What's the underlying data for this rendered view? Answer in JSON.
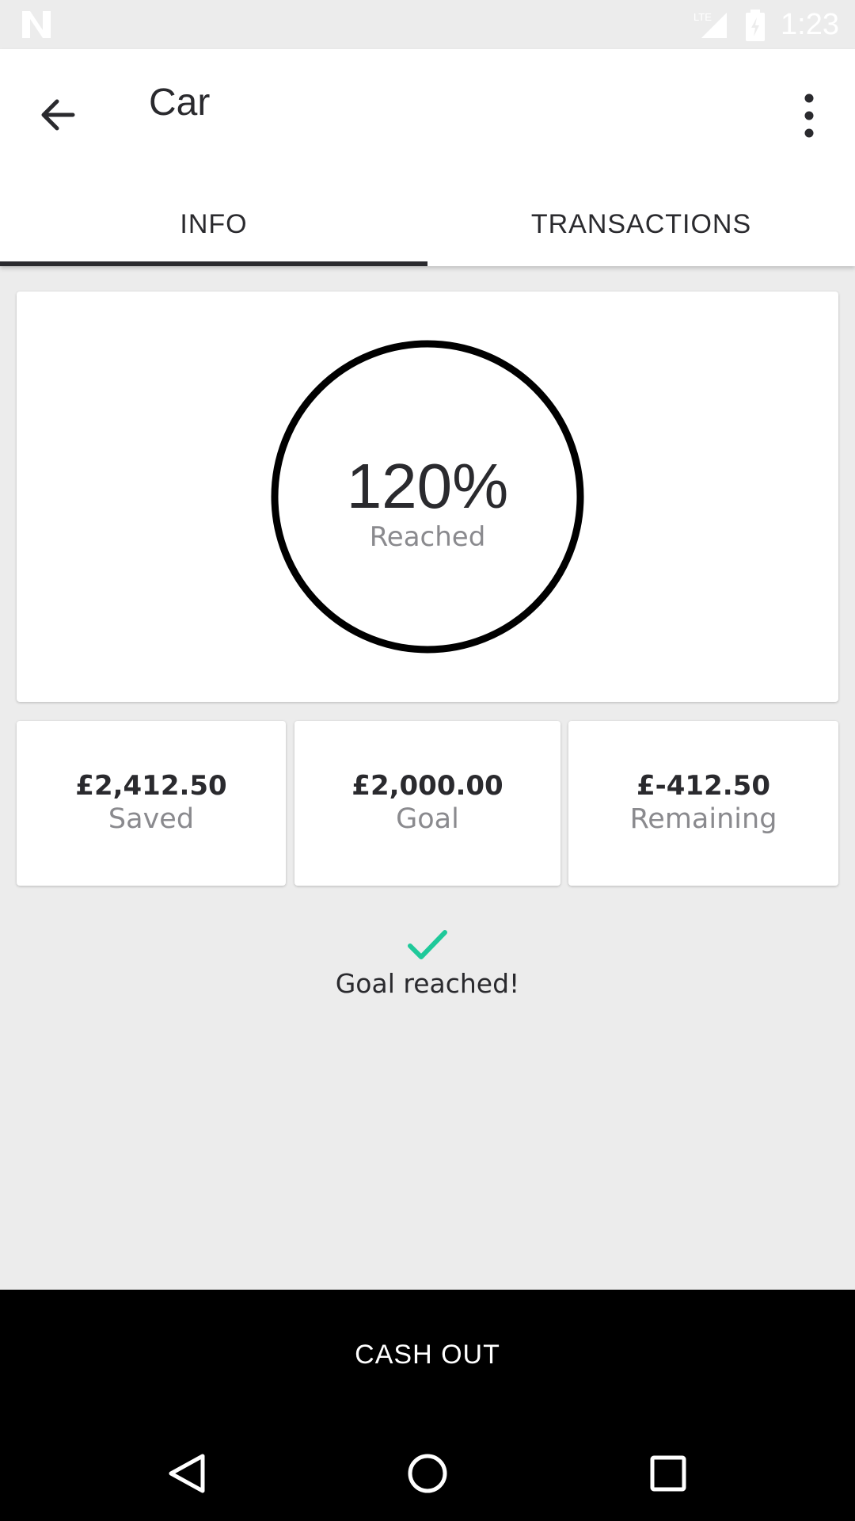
{
  "status_bar": {
    "time": "1:23",
    "network": "LTE"
  },
  "app_bar": {
    "title": "Car",
    "back_icon": "arrow-back-icon",
    "menu_icon": "more-vert-icon"
  },
  "tabs": [
    {
      "label": "INFO",
      "selected": true
    },
    {
      "label": "TRANSACTIONS",
      "selected": false
    }
  ],
  "progress": {
    "percent_text": "120%",
    "label": "Reached",
    "fraction": 1.2
  },
  "stats": [
    {
      "value": "£2,412.50",
      "label": "Saved"
    },
    {
      "value": "£2,000.00",
      "label": "Goal"
    },
    {
      "value": "£-412.50",
      "label": "Remaining"
    }
  ],
  "goal_status": {
    "message": "Goal reached!",
    "icon": "checkmark-icon",
    "icon_color": "#1fc99a"
  },
  "actions": {
    "cash_out_label": "CASH OUT"
  },
  "colors": {
    "accent": "#1fc99a",
    "background": "#ececec",
    "primary_text": "#2a2a2e",
    "secondary_text": "#8a8a8e"
  }
}
